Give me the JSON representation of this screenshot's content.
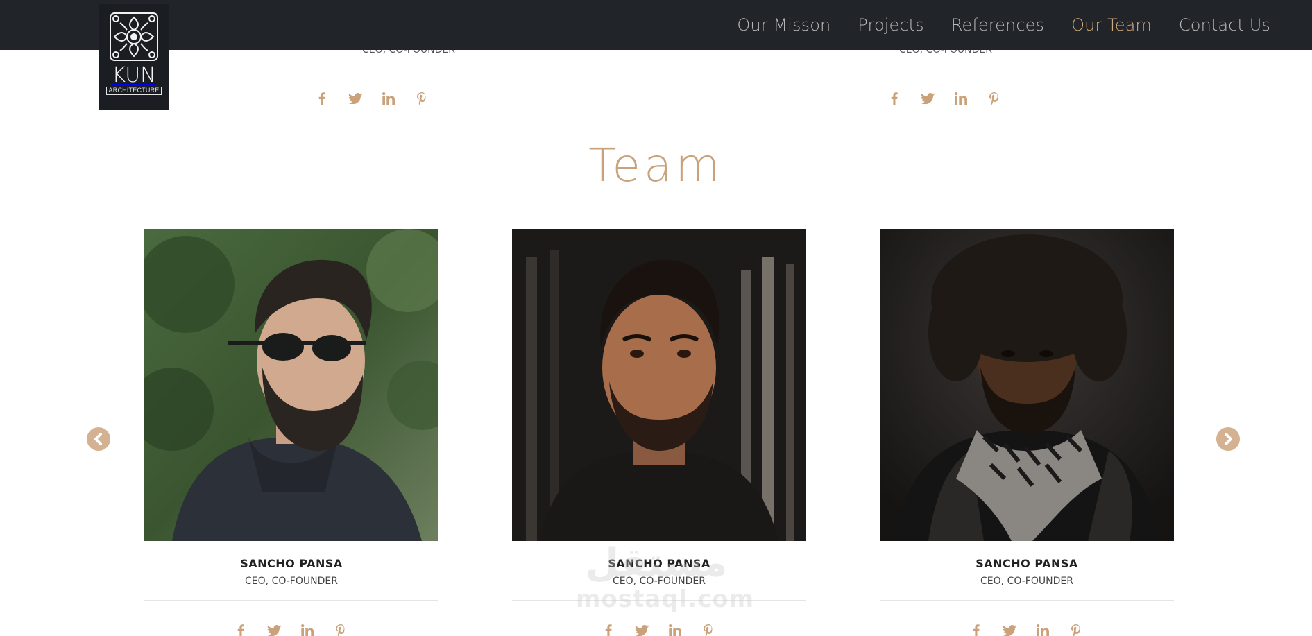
{
  "brand": {
    "logo_word": "KUN",
    "logo_sub": "ARCHITECTURE"
  },
  "nav": {
    "items": [
      {
        "label": "Our Misson"
      },
      {
        "label": "Projects"
      },
      {
        "label": "References"
      },
      {
        "label": "Our Team",
        "active": true
      },
      {
        "label": "Contact Us"
      }
    ]
  },
  "previous_cards": [
    {
      "role": "CEO, CO-FOUNDER"
    },
    {
      "role": "CEO, CO-FOUNDER"
    }
  ],
  "section": {
    "title": "Team"
  },
  "team": [
    {
      "name": "SANCHO PANSA",
      "role": "CEO, CO-FOUNDER"
    },
    {
      "name": "SANCHO PANSA",
      "role": "CEO, CO-FOUNDER"
    },
    {
      "name": "SANCHO PANSA",
      "role": "CEO, CO-FOUNDER"
    }
  ],
  "social_icons": [
    "facebook-icon",
    "twitter-icon",
    "linkedin-icon",
    "pinterest-icon"
  ],
  "carousel": {
    "prev_icon": "chevron-left-icon",
    "next_icon": "chevron-right-icon"
  },
  "watermark": {
    "arabic": "مستقل",
    "latin": "mostaql.com"
  },
  "colors": {
    "nav_bg": "#212429",
    "accent": "#c9a27c",
    "nav_text": "#b7b7b7",
    "nav_active": "#d1a97c"
  }
}
